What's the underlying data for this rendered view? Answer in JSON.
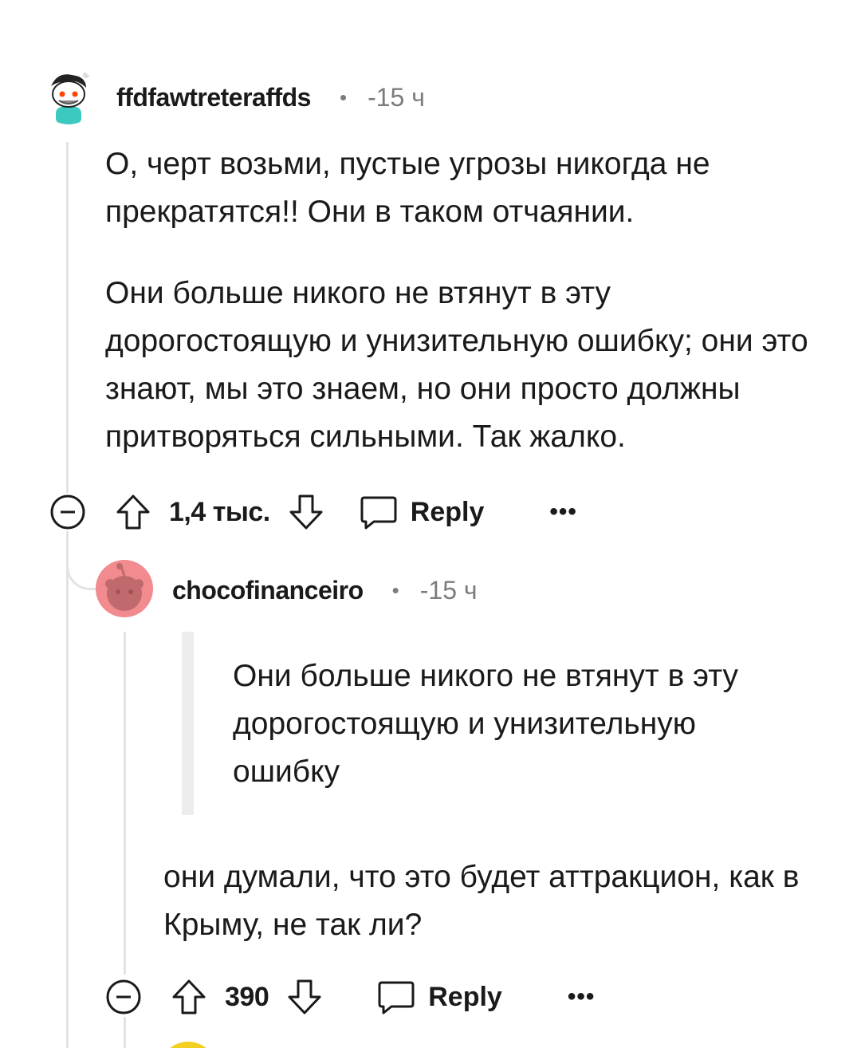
{
  "comments": [
    {
      "username": "ffdfawtreteraffds",
      "separator": "•",
      "time": "-15 ч",
      "paragraphs": [
        "О, черт возьми, пустые угрозы никогда не прекратятся!! Они в таком отчаянии.",
        "Они больше никого не втянут в эту дорогостоящую и унизительную ошибку; они это знают, мы это знаем, но они просто должны притворяться сильными. Так жалко."
      ],
      "votes": "1,4 тыс.",
      "reply_label": "Reply",
      "more_label": "•••"
    },
    {
      "username": "chocofinanceiro",
      "separator": "•",
      "time": "-15 ч",
      "quote": "Они больше никого не втянут в эту дорогостоящую и унизительную ошибку",
      "body": "они думали, что это будет аттракцион, как в Крыму, не так ли?",
      "votes": "390",
      "reply_label": "Reply",
      "more_label": "•••"
    }
  ],
  "colors": {
    "text": "#1a1a1b",
    "meta": "#7c7c7c",
    "thread_line": "#e1e3e5",
    "quote_bar": "#ededed",
    "avatar2_bg": "#f28b8f",
    "next_avatar_bg": "#f2d022"
  }
}
